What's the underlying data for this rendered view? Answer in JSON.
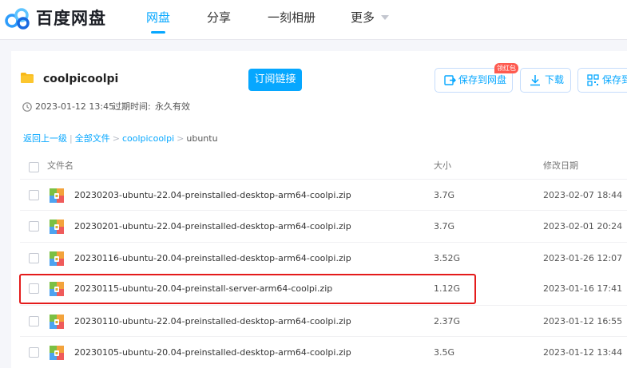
{
  "header": {
    "brand": "百度网盘",
    "nav": [
      "网盘",
      "分享",
      "一刻相册",
      "更多"
    ]
  },
  "share": {
    "title": "coolpicoolpi",
    "subscribe": "订阅链接",
    "save_to_netdisk": "保存到网盘",
    "download": "下载",
    "save_to_phone": "保存到",
    "badge": "领红包",
    "created": "2023-01-12 13:45",
    "expire_label": "过期时间:",
    "expire_value": "永久有效"
  },
  "breadcrumb": {
    "back": "返回上一级",
    "all": "全部文件",
    "folder": "coolpicoolpi",
    "current": "ubuntu"
  },
  "table": {
    "columns": [
      "文件名",
      "大小",
      "修改日期"
    ],
    "rows": [
      {
        "name": "20230203-ubuntu-22.04-preinstalled-desktop-arm64-coolpi.zip",
        "size": "3.7G",
        "date": "2023-02-07 18:44"
      },
      {
        "name": "20230201-ubuntu-22.04-preinstalled-desktop-arm64-coolpi.zip",
        "size": "3.7G",
        "date": "2023-02-01 20:24"
      },
      {
        "name": "20230116-ubuntu-20.04-preinstalled-desktop-arm64-coolpi.zip",
        "size": "3.52G",
        "date": "2023-01-26 12:07"
      },
      {
        "name": "20230115-ubuntu-20.04-preinstall-server-arm64-coolpi.zip",
        "size": "1.12G",
        "date": "2023-01-16 17:41"
      },
      {
        "name": "20230110-ubuntu-22.04-preinstalled-desktop-arm64-coolpi.zip",
        "size": "2.37G",
        "date": "2023-01-12 16:55"
      },
      {
        "name": "20230105-ubuntu-20.04-preinstalled-desktop-arm64-coolpi.zip",
        "size": "3.5G",
        "date": "2023-01-12 13:44"
      }
    ]
  },
  "icons": {
    "logo": "baidu-netdisk-logo",
    "folder": "folder-icon",
    "zip": "zip-file-icon",
    "clock": "clock-icon",
    "save": "save-to-cloud-icon",
    "download": "download-icon",
    "phone": "qrcode-icon"
  },
  "colors": {
    "accent": "#06a7ff",
    "highlight": "#e41b1b",
    "badge": "#fe5a4f"
  }
}
